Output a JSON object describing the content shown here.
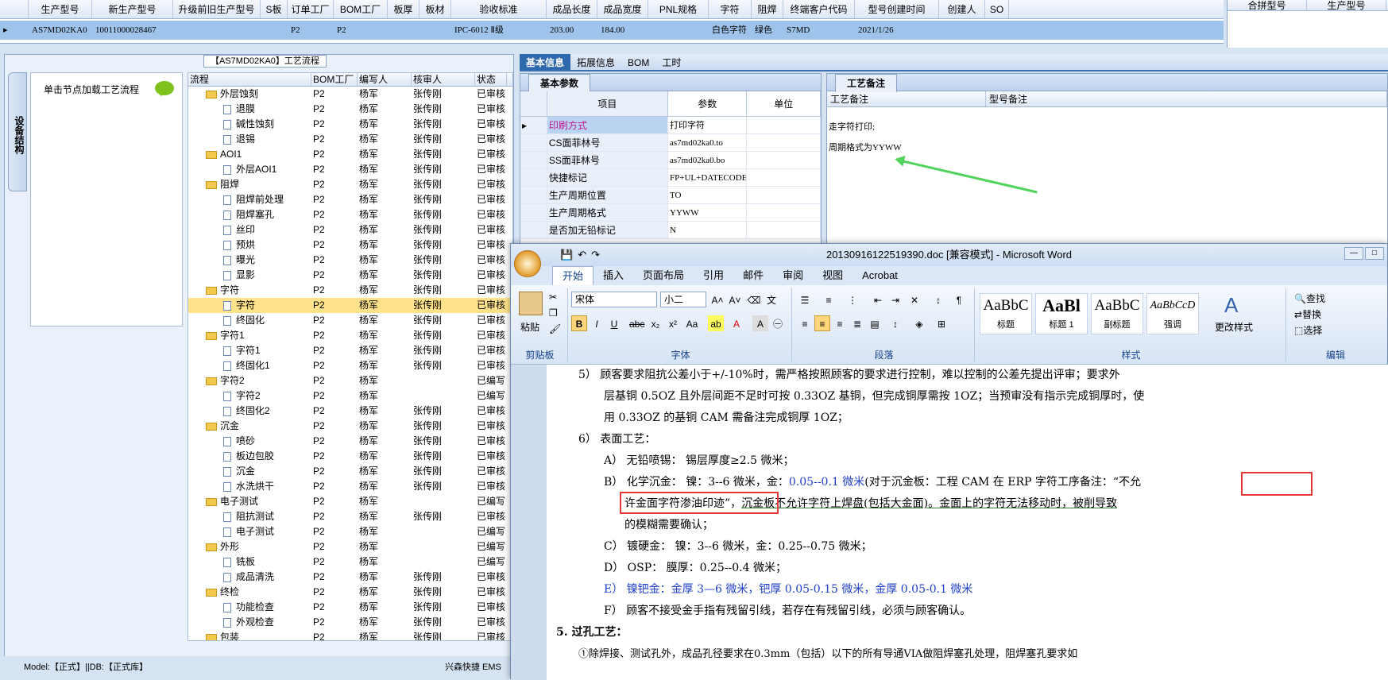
{
  "top_grid": {
    "headers": [
      "生产型号",
      "新生产型号",
      "升级前旧生产型号",
      "S板",
      "订单工厂",
      "BOM工厂",
      "板厚",
      "板材",
      "验收标准",
      "成品长度",
      "成品宽度",
      "PNL规格",
      "字符",
      "阻焊",
      "终端客户代码",
      "型号创建时间",
      "创建人",
      "SO"
    ],
    "row": [
      "AS7MD02KA0",
      "10011000028467",
      "",
      "",
      "P2",
      "P2",
      "",
      "",
      "IPC-6012 Ⅱ级",
      "203.00",
      "184.00",
      "",
      "白色字符",
      "绿色",
      "S7MD",
      "2021/1/26",
      "",
      ""
    ]
  },
  "right_grid": {
    "headers": [
      "合拼型号",
      "生产型号"
    ]
  },
  "left_panel": {
    "title": "【AS7MD02KA0】工艺流程",
    "vtab": "设备结构",
    "hint": "单击节点加载工艺流程",
    "tree_headers": [
      "流程",
      "BOM工厂",
      "编写人",
      "核审人",
      "状态"
    ],
    "rows": [
      {
        "name": "外层蚀刻",
        "type": "folder",
        "bom": "P2",
        "writer": "杨军",
        "reviewer": "张传刚",
        "status": "已审核"
      },
      {
        "name": "退膜",
        "type": "doc",
        "bom": "P2",
        "writer": "杨军",
        "reviewer": "张传刚",
        "status": "已审核"
      },
      {
        "name": "碱性蚀刻",
        "type": "doc",
        "bom": "P2",
        "writer": "杨军",
        "reviewer": "张传刚",
        "status": "已审核"
      },
      {
        "name": "退锡",
        "type": "doc",
        "bom": "P2",
        "writer": "杨军",
        "reviewer": "张传刚",
        "status": "已审核"
      },
      {
        "name": "AOI1",
        "type": "folder",
        "bom": "P2",
        "writer": "杨军",
        "reviewer": "张传刚",
        "status": "已审核"
      },
      {
        "name": "外层AOI1",
        "type": "doc",
        "bom": "P2",
        "writer": "杨军",
        "reviewer": "张传刚",
        "status": "已审核"
      },
      {
        "name": "阻焊",
        "type": "folder",
        "bom": "P2",
        "writer": "杨军",
        "reviewer": "张传刚",
        "status": "已审核"
      },
      {
        "name": "阻焊前处理",
        "type": "doc",
        "bom": "P2",
        "writer": "杨军",
        "reviewer": "张传刚",
        "status": "已审核"
      },
      {
        "name": "阻焊塞孔",
        "type": "doc",
        "bom": "P2",
        "writer": "杨军",
        "reviewer": "张传刚",
        "status": "已审核"
      },
      {
        "name": "丝印",
        "type": "doc",
        "bom": "P2",
        "writer": "杨军",
        "reviewer": "张传刚",
        "status": "已审核"
      },
      {
        "name": "预烘",
        "type": "doc",
        "bom": "P2",
        "writer": "杨军",
        "reviewer": "张传刚",
        "status": "已审核"
      },
      {
        "name": "曝光",
        "type": "doc",
        "bom": "P2",
        "writer": "杨军",
        "reviewer": "张传刚",
        "status": "已审核"
      },
      {
        "name": "显影",
        "type": "doc",
        "bom": "P2",
        "writer": "杨军",
        "reviewer": "张传刚",
        "status": "已审核"
      },
      {
        "name": "字符",
        "type": "folder",
        "bom": "P2",
        "writer": "杨军",
        "reviewer": "张传刚",
        "status": "已审核"
      },
      {
        "name": "字符",
        "type": "doc",
        "bom": "P2",
        "writer": "杨军",
        "reviewer": "张传刚",
        "status": "已审核",
        "selected": true
      },
      {
        "name": "终固化",
        "type": "doc",
        "bom": "P2",
        "writer": "杨军",
        "reviewer": "张传刚",
        "status": "已审核"
      },
      {
        "name": "字符1",
        "type": "folder",
        "bom": "P2",
        "writer": "杨军",
        "reviewer": "张传刚",
        "status": "已审核"
      },
      {
        "name": "字符1",
        "type": "doc",
        "bom": "P2",
        "writer": "杨军",
        "reviewer": "张传刚",
        "status": "已审核"
      },
      {
        "name": "终固化1",
        "type": "doc",
        "bom": "P2",
        "writer": "杨军",
        "reviewer": "张传刚",
        "status": "已审核"
      },
      {
        "name": "字符2",
        "type": "folder",
        "bom": "P2",
        "writer": "杨军",
        "reviewer": "",
        "status": "已编写"
      },
      {
        "name": "字符2",
        "type": "doc",
        "bom": "P2",
        "writer": "杨军",
        "reviewer": "",
        "status": "已编写"
      },
      {
        "name": "终固化2",
        "type": "doc",
        "bom": "P2",
        "writer": "杨军",
        "reviewer": "张传刚",
        "status": "已审核"
      },
      {
        "name": "沉金",
        "type": "folder",
        "bom": "P2",
        "writer": "杨军",
        "reviewer": "张传刚",
        "status": "已审核"
      },
      {
        "name": "喷砂",
        "type": "doc",
        "bom": "P2",
        "writer": "杨军",
        "reviewer": "张传刚",
        "status": "已审核"
      },
      {
        "name": "板边包胶",
        "type": "doc",
        "bom": "P2",
        "writer": "杨军",
        "reviewer": "张传刚",
        "status": "已审核"
      },
      {
        "name": "沉金",
        "type": "doc",
        "bom": "P2",
        "writer": "杨军",
        "reviewer": "张传刚",
        "status": "已审核"
      },
      {
        "name": "水洗烘干",
        "type": "doc",
        "bom": "P2",
        "writer": "杨军",
        "reviewer": "张传刚",
        "status": "已审核"
      },
      {
        "name": "电子测试",
        "type": "folder",
        "bom": "P2",
        "writer": "杨军",
        "reviewer": "",
        "status": "已编写"
      },
      {
        "name": "阻抗测试",
        "type": "doc",
        "bom": "P2",
        "writer": "杨军",
        "reviewer": "张传刚",
        "status": "已审核"
      },
      {
        "name": "电子测试",
        "type": "doc",
        "bom": "P2",
        "writer": "杨军",
        "reviewer": "",
        "status": "已编写"
      },
      {
        "name": "外形",
        "type": "folder",
        "bom": "P2",
        "writer": "杨军",
        "reviewer": "",
        "status": "已编写"
      },
      {
        "name": "铣板",
        "type": "doc",
        "bom": "P2",
        "writer": "杨军",
        "reviewer": "",
        "status": "已编写"
      },
      {
        "name": "成品清洗",
        "type": "doc",
        "bom": "P2",
        "writer": "杨军",
        "reviewer": "张传刚",
        "status": "已审核"
      },
      {
        "name": "终检",
        "type": "folder",
        "bom": "P2",
        "writer": "杨军",
        "reviewer": "张传刚",
        "status": "已审核"
      },
      {
        "name": "功能检查",
        "type": "doc",
        "bom": "P2",
        "writer": "杨军",
        "reviewer": "张传刚",
        "status": "已审核"
      },
      {
        "name": "外观检查",
        "type": "doc",
        "bom": "P2",
        "writer": "杨军",
        "reviewer": "张传刚",
        "status": "已审核"
      },
      {
        "name": "包装",
        "type": "folder",
        "bom": "P2",
        "writer": "杨军",
        "reviewer": "张传刚",
        "status": "已审核"
      }
    ]
  },
  "status_bar": {
    "left": "Model:【正式】||DB:【正式库】",
    "right": "兴森快捷 EMS"
  },
  "tabs": [
    "基本信息",
    "拓展信息",
    "BOM",
    "工时"
  ],
  "basic": {
    "subtab": "基本参数",
    "headers": [
      "项目",
      "参数",
      "单位"
    ],
    "rows": [
      {
        "item": "印刷方式",
        "param": "打印字符"
      },
      {
        "item": "CS面菲林号",
        "param": "as7md02ka0.to"
      },
      {
        "item": "SS面菲林号",
        "param": "as7md02ka0.bo"
      },
      {
        "item": "快捷标记",
        "param": "FP+UL+DATECODE"
      },
      {
        "item": "生产周期位置",
        "param": "TO"
      },
      {
        "item": "生产周期格式",
        "param": "YYWW"
      },
      {
        "item": "是否加无铅标记",
        "param": "N"
      }
    ]
  },
  "notes": {
    "subtab": "工艺备注",
    "col1": "工艺备注",
    "col2": "型号备注",
    "line1": "走字符打印;",
    "line2": "周期格式为YYWW"
  },
  "word": {
    "title": "20130916122519390.doc [兼容模式] - Microsoft Word",
    "tabs": [
      "开始",
      "插入",
      "页面布局",
      "引用",
      "邮件",
      "审阅",
      "视图",
      "Acrobat"
    ],
    "font": "宋体",
    "size": "小二",
    "groups": {
      "clipboard": "剪贴板",
      "font": "字体",
      "paragraph": "段落",
      "styles": "样式",
      "edit": "编辑"
    },
    "paste": "粘贴",
    "styles": [
      {
        "sample": "AaBbC",
        "name": "标题"
      },
      {
        "sample": "AaBl",
        "name": "标题 1"
      },
      {
        "sample": "AaBbC",
        "name": "副标题"
      },
      {
        "sample": "AaBbCcD",
        "name": "强调"
      }
    ],
    "change_styles": "更改样式",
    "edit": [
      "查找",
      "替换",
      "选择"
    ],
    "lines": [
      "5） 顾客要求阻抗公差小于+/-10%时，需严格按照顾客的要求进行控制，难以控制的公差先提出评审；要求外",
      "层基铜 0.5OZ 且外层间距不足时可按 0.33OZ 基铜，但完成铜厚需按 1OZ；当预审没有指示完成铜厚时，使",
      "用 0.33OZ 的基铜 CAM 需备注完成铜厚 1OZ；",
      "6） 表面工艺：",
      "A） 无铅喷锡： 锡层厚度≥2.5 微米；",
      "B） 化学沉金： 镍：3--6 微米，金：",
      "0.05--0.1 微米",
      "(对于沉金板：工程 CAM 在 ERP 字符工序备注：“不允",
      "许金面字符渗油印迹”，",
      "沉金板不允许字符上焊盘(包括大金面)。金面上的字符无法移动时，被削导致",
      "的模糊需要确认；",
      "C） 镀硬金： 镍：3--6 微米，金：0.25--0.75 微米；",
      "D） OSP： 膜厚：0.25--0.4 微米；",
      "E） 镍钯金：金厚 3—6 微米，钯厚 0.05-0.15 微米，金厚 0.05-0.1 微米",
      "F） 顾客不接受金手指有残留引线，若存在有残留引线，必须与顾客确认。",
      "5. 过孔工艺：",
      "①除焊接、测试孔外，成品孔径要求在0.3mm（包括）以下的所有导通VIA做阻焊塞孔处理，阻焊塞孔要求如"
    ]
  }
}
